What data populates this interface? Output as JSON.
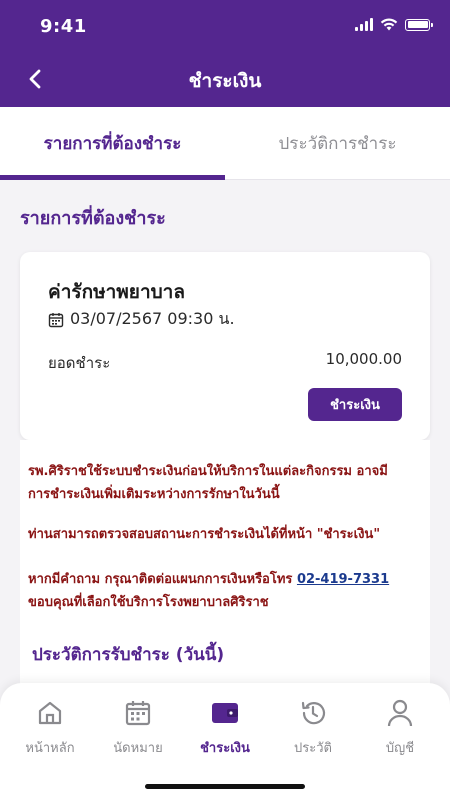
{
  "status_bar": {
    "time": "9:41"
  },
  "header": {
    "title": "ชำระเงิน"
  },
  "tabs": [
    {
      "label": "รายการที่ต้องชำระ",
      "active": true
    },
    {
      "label": "ประวัติการชำระ",
      "active": false
    }
  ],
  "section": {
    "title": "รายการที่ต้องชำระ"
  },
  "bill": {
    "name": "ค่ารักษาพยาบาล",
    "datetime": "03/07/2567 09:30 น.",
    "amount_label": "ยอดชำระ",
    "amount_value": "10,000.00",
    "pay_button_label": "ชำระเงิน"
  },
  "notices": {
    "line1": "รพ.ศิริราชใช้ระบบชำระเงินก่อนให้บริการในแต่ละกิจกรรม อาจมีการชำระเงินเพิ่มเติมระหว่างการรักษาในวันนี้",
    "line2": "ท่านสามารถตรวจสอบสถานะการชำระเงินได้ที่หน้า \"ชำระเงิน\"",
    "line3_prefix": "หากมีคำถาม กรุณาติดต่อแผนกการเงินหรือโทร",
    "phone": "02-419-7331",
    "line3_suffix": "ขอบคุณที่เลือกใช้บริการโรงพยาบาลศิริราช"
  },
  "history": {
    "title": "ประวัติการรับชำระ (วันนี้)"
  },
  "bottom_nav": [
    {
      "label": "หน้าหลัก",
      "icon": "home-icon",
      "active": false
    },
    {
      "label": "นัดหมาย",
      "icon": "calendar-icon",
      "active": false
    },
    {
      "label": "ชำระเงิน",
      "icon": "wallet-icon",
      "active": true
    },
    {
      "label": "ประวัติ",
      "icon": "history-icon",
      "active": false
    },
    {
      "label": "บัญชี",
      "icon": "user-icon",
      "active": false
    }
  ],
  "colors": {
    "brand": "#54268f",
    "notice_text": "#8a1414",
    "link": "#1b3a8e",
    "inactive_nav": "#8a8a8e"
  }
}
